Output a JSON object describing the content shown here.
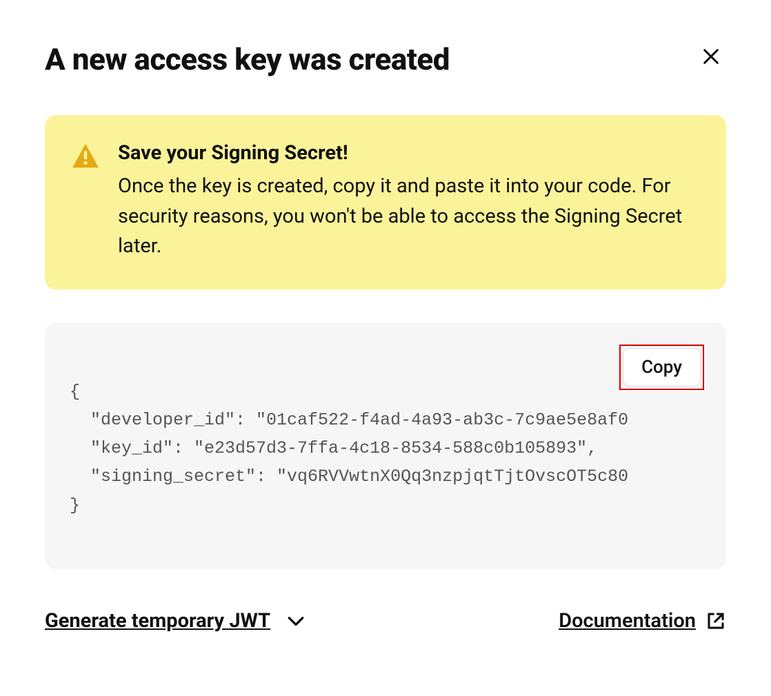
{
  "header": {
    "title": "A new access key was created"
  },
  "alert": {
    "title": "Save your Signing Secret!",
    "body": "Once the key is created, copy it and paste it into your code. For security reasons, you won't be able to access the Signing Secret later."
  },
  "code": {
    "copy_label": "Copy",
    "content": "{\n  \"developer_id\": \"01caf522-f4ad-4a93-ab3c-7c9ae5e8af0\n  \"key_id\": \"e23d57d3-7ffa-4c18-8534-588c0b105893\",\n  \"signing_secret\": \"vq6RVVwtnX0Qq3nzpjqtTjtOvscOT5c80\n}"
  },
  "footer": {
    "jwt_label": "Generate temporary JWT",
    "doc_label": "Documentation"
  }
}
